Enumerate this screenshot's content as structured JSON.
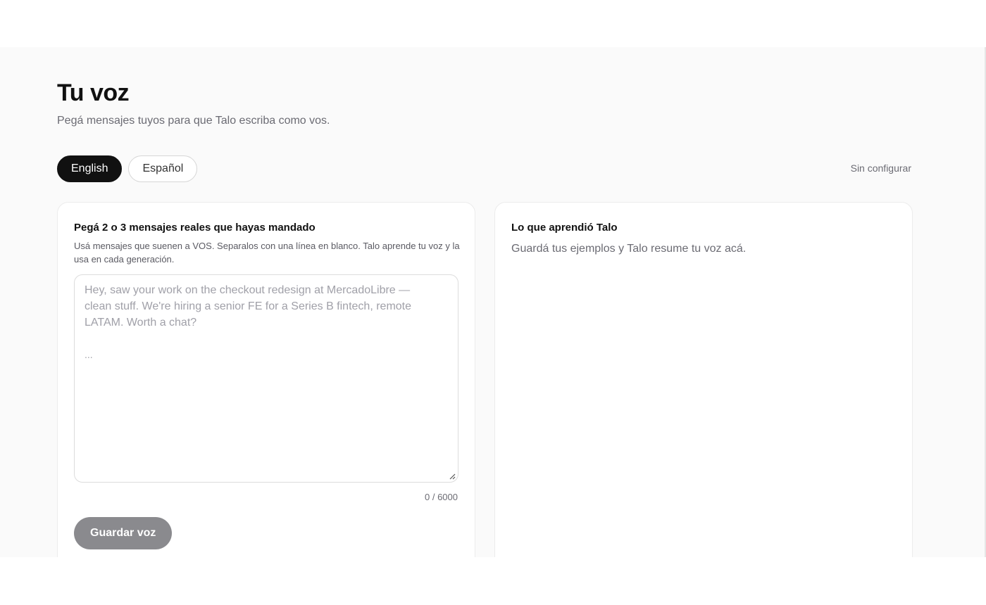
{
  "page": {
    "title": "Tu voz",
    "subtitle": "Pegá mensajes tuyos para que Talo escriba como vos."
  },
  "language_tabs": [
    {
      "label": "English",
      "active": true
    },
    {
      "label": "Español",
      "active": false
    }
  ],
  "status": "Sin configurar",
  "input_card": {
    "title": "Pegá 2 o 3 mensajes reales que hayas mandado",
    "description": "Usá mensajes que suenen a VOS. Separalos con una línea en blanco. Talo aprende tu voz y la usa en cada generación.",
    "textarea_value": "",
    "placeholder_lines": [
      "Hey, saw your work on the checkout redesign at MercadoLibre —",
      "clean stuff. We're hiring a senior FE for a Series B fintech, remote",
      "LATAM. Worth a chat?",
      "..."
    ],
    "char_count": "0 / 6000",
    "save_label": "Guardar voz"
  },
  "learned_card": {
    "title": "Lo que aprendió Talo",
    "empty_text": "Guardá tus ejemplos y Talo resume tu voz acá."
  },
  "colors": {
    "active_tab_bg": "#111111",
    "save_button_disabled_bg": "#8a8a8e",
    "page_bg": "#fafafa"
  }
}
